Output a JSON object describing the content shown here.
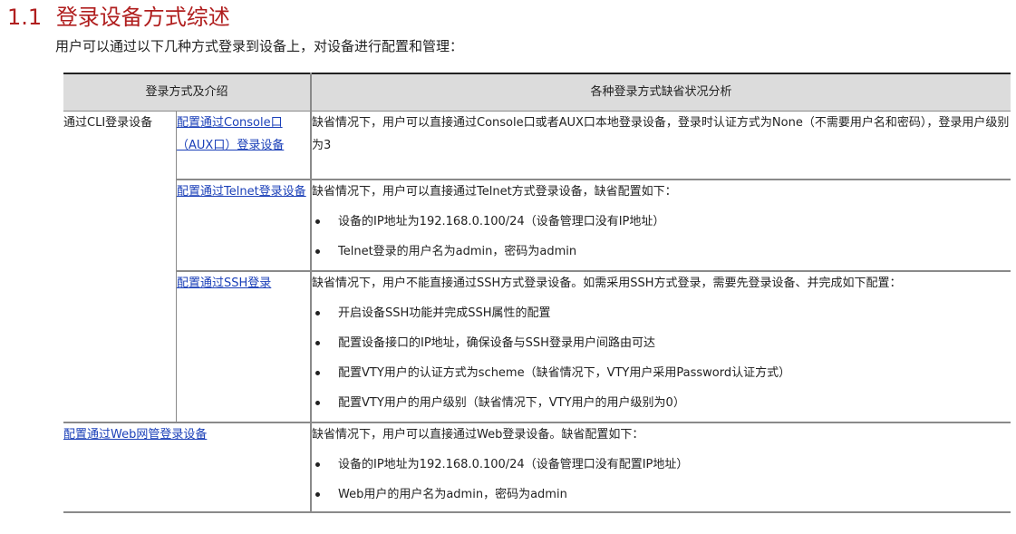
{
  "section": {
    "number": "1.1",
    "title": "登录设备方式综述",
    "intro": "用户可以通过以下几种方式登录到设备上，对设备进行配置和管理："
  },
  "table": {
    "headers": [
      "登录方式及介绍",
      "各种登录方式缺省状况分析"
    ],
    "cli_group_label": "通过CLI登录设备",
    "rows": [
      {
        "link": "配置通过Console口（AUX口）登录设备",
        "text": "缺省情况下，用户可以直接通过Console口或者AUX口本地登录设备，登录时认证方式为None（不需要用户名和密码），登录用户级别为3",
        "bullets": []
      },
      {
        "link": "配置通过Telnet登录设备",
        "text": "缺省情况下，用户可以直接通过Telnet方式登录设备，缺省配置如下：",
        "bullets": [
          "设备的IP地址为192.168.0.100/24（设备管理口没有IP地址）",
          "Telnet登录的用户名为admin，密码为admin"
        ]
      },
      {
        "link": "配置通过SSH登录",
        "text": "缺省情况下，用户不能直接通过SSH方式登录设备。如需采用SSH方式登录，需要先登录设备、并完成如下配置：",
        "bullets": [
          "开启设备SSH功能并完成SSH属性的配置",
          "配置设备接口的IP地址，确保设备与SSH登录用户间路由可达",
          "配置VTY用户的认证方式为scheme（缺省情况下，VTY用户采用Password认证方式）",
          "配置VTY用户的用户级别（缺省情况下，VTY用户的用户级别为0）"
        ]
      }
    ],
    "web_row": {
      "link": "配置通过Web网管登录设备",
      "text": "缺省情况下，用户可以直接通过Web登录设备。缺省配置如下：",
      "bullets": [
        "设备的IP地址为192.168.0.100/24（设备管理口没有配置IP地址）",
        "Web用户的用户名为admin，密码为admin"
      ]
    }
  }
}
